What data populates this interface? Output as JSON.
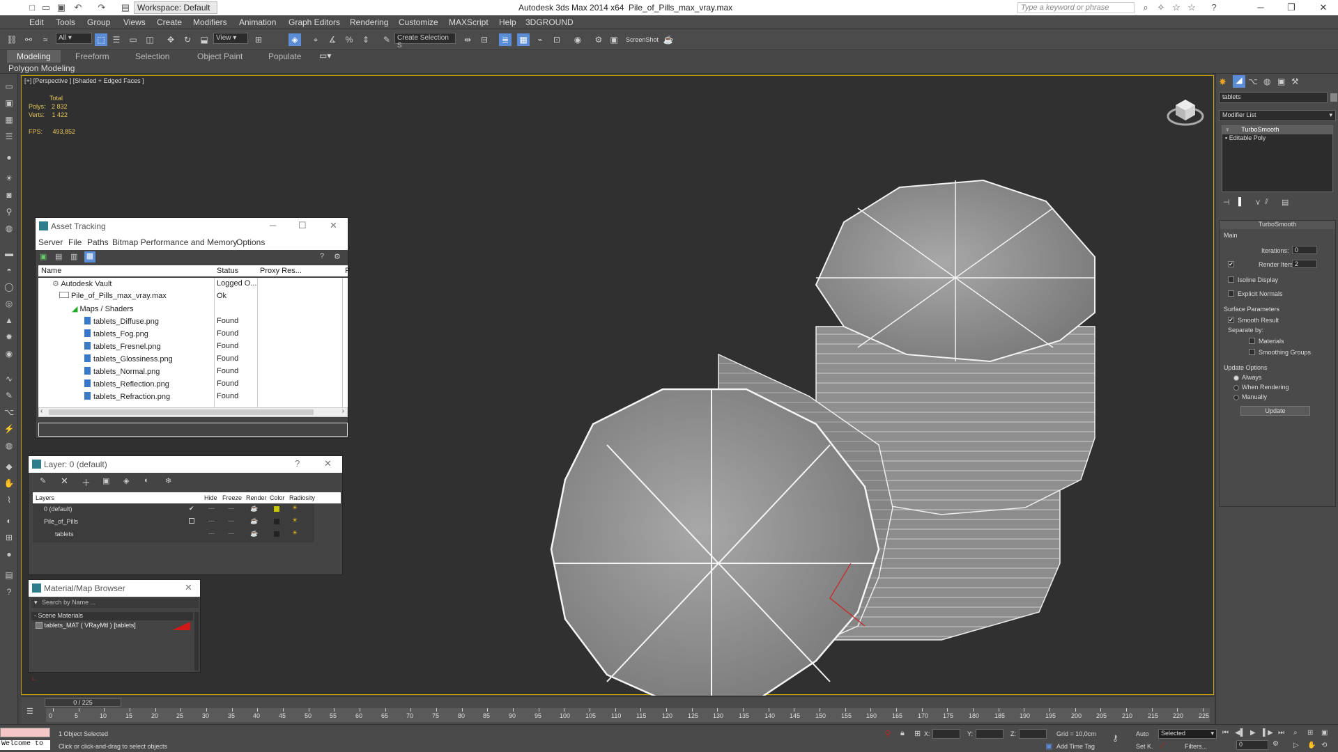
{
  "app": {
    "title": "Autodesk 3ds Max  2014 x64",
    "file": "Pile_of_Pills_max_vray.max",
    "workspace": "Workspace: Default",
    "search_placeholder": "Type a keyword or phrase"
  },
  "menu": [
    "Edit",
    "Tools",
    "Group",
    "Views",
    "Create",
    "Modifiers",
    "Animation",
    "Graph Editors",
    "Rendering",
    "Customize",
    "MAXScript",
    "Help",
    "3DGROUND"
  ],
  "toolbar": {
    "filter": "All",
    "refcoord": "View",
    "named_sel": "Create Selection S",
    "screenshot": "ScreenShot"
  },
  "ribbon": {
    "tabs": [
      "Modeling",
      "Freeform",
      "Selection",
      "Object Paint",
      "Populate"
    ],
    "active": "Modeling",
    "sub": "Polygon Modeling"
  },
  "viewport": {
    "label": "[+] [Perspective ] [Shaded + Edged Faces ]",
    "stats_total": "Total",
    "polys_label": "Polys:",
    "polys": "2 832",
    "verts_label": "Verts:",
    "verts": "1 422",
    "fps_label": "FPS:",
    "fps": "493,852"
  },
  "asset_tracking": {
    "title": "Asset Tracking",
    "menu": [
      "Server",
      "File",
      "Paths",
      "Bitmap Performance and Memory",
      "Options"
    ],
    "columns": [
      "Name",
      "Status",
      "Proxy Res...",
      "P"
    ],
    "rows": [
      {
        "name": "Autodesk Vault",
        "status": "Logged O..."
      },
      {
        "name": "Pile_of_Pills_max_vray.max",
        "status": "Ok"
      },
      {
        "name": "Maps / Shaders",
        "status": ""
      },
      {
        "name": "tablets_Diffuse.png",
        "status": "Found"
      },
      {
        "name": "tablets_Fog.png",
        "status": "Found"
      },
      {
        "name": "tablets_Fresnel.png",
        "status": "Found"
      },
      {
        "name": "tablets_Glossiness.png",
        "status": "Found"
      },
      {
        "name": "tablets_Normal.png",
        "status": "Found"
      },
      {
        "name": "tablets_Reflection.png",
        "status": "Found"
      },
      {
        "name": "tablets_Refraction.png",
        "status": "Found"
      }
    ]
  },
  "layer_panel": {
    "title": "Layer: 0 (default)",
    "help": "?",
    "columns": [
      "Layers",
      "Hide",
      "Freeze",
      "Render",
      "Color",
      "Radiosity"
    ],
    "rows": [
      {
        "name": "0 (default)",
        "color": "#c8c800"
      },
      {
        "name": "Pile_of_Pills",
        "color": "#222222"
      },
      {
        "name": "tablets",
        "color": "#222222"
      }
    ]
  },
  "material_browser": {
    "title": "Material/Map Browser",
    "search_placeholder": "Search by Name ...",
    "group": "- Scene Materials",
    "item": "tablets_MAT  ( VRayMtl )  [tablets]"
  },
  "command_panel": {
    "object_name": "tablets",
    "modifier_list": "Modifier List",
    "stack": [
      "TurboSmooth",
      "Editable Poly"
    ],
    "turbosmooth": {
      "title": "TurboSmooth",
      "main": "Main",
      "iterations_label": "Iterations:",
      "iterations": "0",
      "render_iters_label": "Render Iters:",
      "render_iters": "2",
      "isoline": "Isoline Display",
      "explicit": "Explicit Normals",
      "surface": "Surface Parameters",
      "smooth": "Smooth Result",
      "separate": "Separate by:",
      "materials": "Materials",
      "smoothing": "Smoothing Groups",
      "update_opts": "Update Options",
      "always": "Always",
      "when_rendering": "When Rendering",
      "manually": "Manually",
      "update_btn": "Update"
    }
  },
  "timeline": {
    "slider": "0 / 225",
    "ticks": [
      "0",
      "5",
      "10",
      "15",
      "20",
      "25",
      "30",
      "35",
      "40",
      "45",
      "50",
      "55",
      "60",
      "65",
      "70",
      "75",
      "80",
      "85",
      "90",
      "95",
      "100",
      "105",
      "110",
      "115",
      "120",
      "125",
      "130",
      "135",
      "140",
      "145",
      "150",
      "155",
      "160",
      "165",
      "170",
      "175",
      "180",
      "185",
      "190",
      "195",
      "200",
      "205",
      "210",
      "215",
      "220",
      "225"
    ]
  },
  "status": {
    "welcome": "Welcome to",
    "selected": "1 Object Selected",
    "prompt": "Click or click-and-drag to select objects",
    "x": "X:",
    "y": "Y:",
    "z": "Z:",
    "grid": "Grid = 10,0cm",
    "auto": "Auto",
    "set_key": "Set K.",
    "add_time_tag": "Add Time Tag",
    "key_mode": "Selected",
    "filters": "Filters...",
    "frame": "0"
  }
}
